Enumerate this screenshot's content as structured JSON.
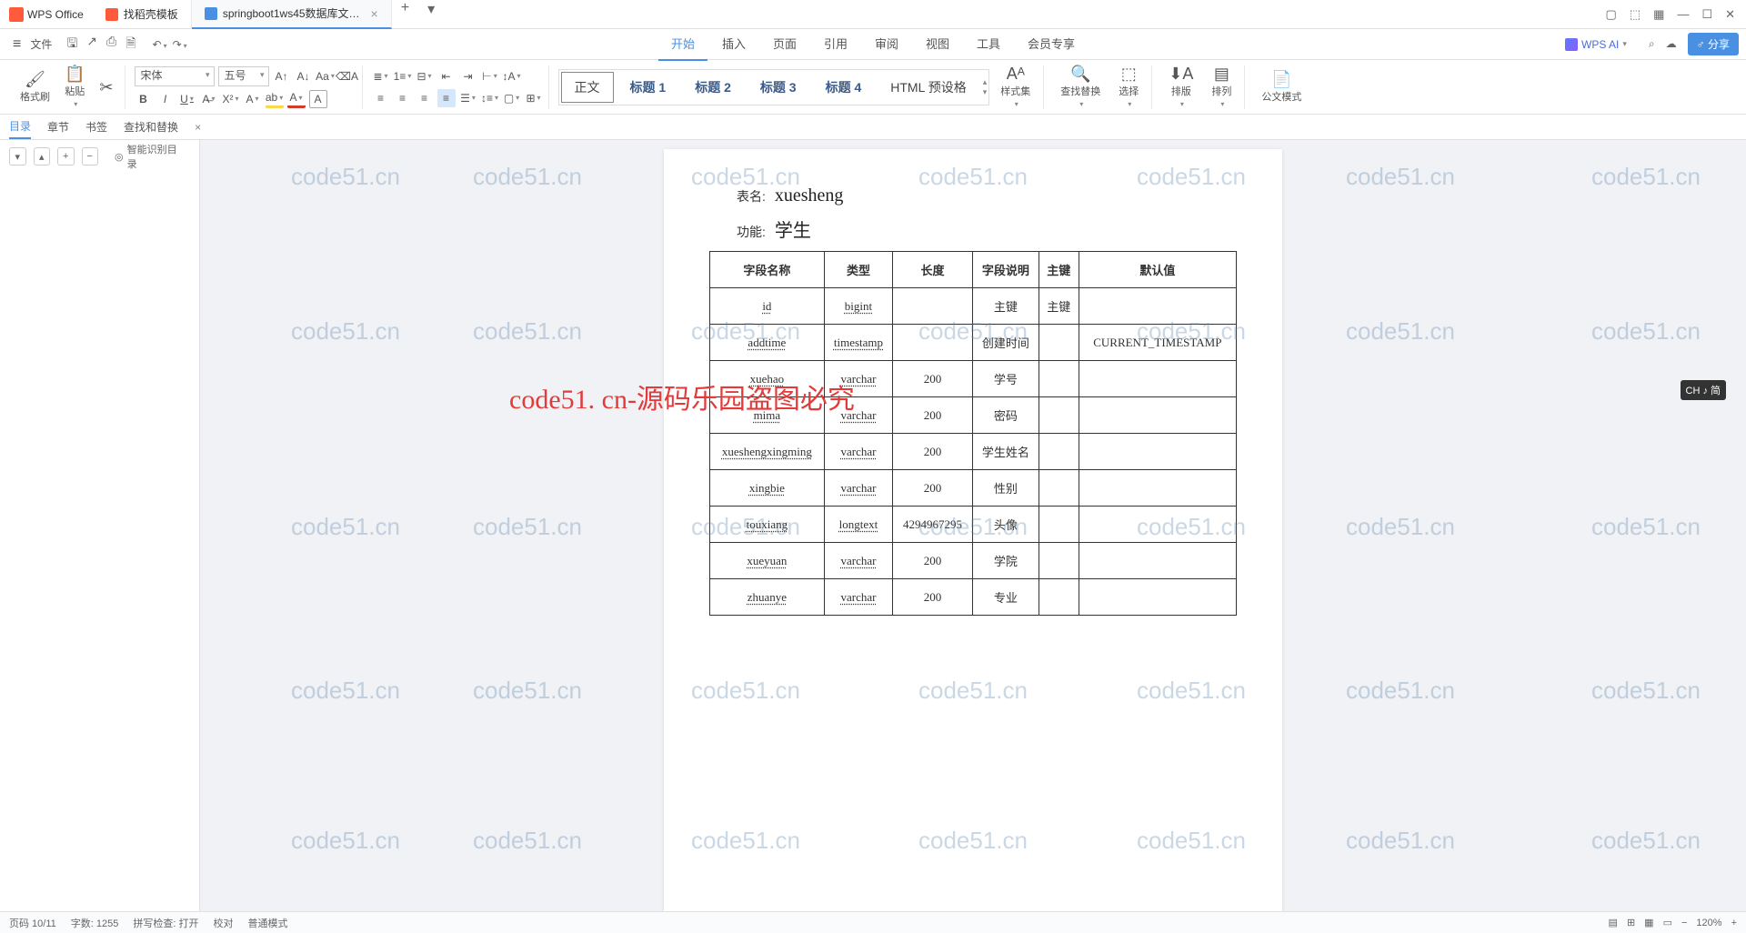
{
  "titlebar": {
    "app_name": "WPS Office",
    "tabs": [
      {
        "label": "找稻壳模板"
      },
      {
        "label": "springboot1ws45数据库文…"
      }
    ]
  },
  "menus": {
    "file": "文件",
    "items": [
      "开始",
      "插入",
      "页面",
      "引用",
      "审阅",
      "视图",
      "工具",
      "会员专享"
    ],
    "wps_ai": "WPS AI",
    "share": "分享"
  },
  "qat": {
    "undo": "↶",
    "redo": "↷"
  },
  "ribbon": {
    "format_painter": "格式刷",
    "paste": "粘贴",
    "font_name": "宋体",
    "font_size": "五号",
    "bold": "B",
    "italic": "I",
    "underline": "U",
    "style_main": "正文",
    "style_h1": "标题 1",
    "style_h2": "标题 2",
    "style_h3": "标题 3",
    "style_h4": "标题 4",
    "style_html": "HTML 预设格",
    "style_set": "样式集",
    "find_replace": "查找替换",
    "select": "选择",
    "layout": "排版",
    "arrange": "排列",
    "official": "公文模式"
  },
  "navpanel": {
    "tabs": [
      "目录",
      "章节",
      "书签",
      "查找和替换"
    ],
    "smart_toc": "智能识别目录"
  },
  "document": {
    "table_name_label": "表名:",
    "table_name_value": "xuesheng",
    "function_label": "功能:",
    "function_value": "学生",
    "columns": [
      "字段名称",
      "类型",
      "长度",
      "字段说明",
      "主键",
      "默认值"
    ],
    "rows": [
      {
        "name": "id",
        "type": "bigint",
        "len": "",
        "desc": "主键",
        "pk": "主键",
        "def": ""
      },
      {
        "name": "addtime",
        "type": "timestamp",
        "len": "",
        "desc": "创建时间",
        "pk": "",
        "def": "CURRENT_TIMESTAMP"
      },
      {
        "name": "xuehao",
        "type": "varchar",
        "len": "200",
        "desc": "学号",
        "pk": "",
        "def": ""
      },
      {
        "name": "mima",
        "type": "varchar",
        "len": "200",
        "desc": "密码",
        "pk": "",
        "def": ""
      },
      {
        "name": "xueshengxingming",
        "type": "varchar",
        "len": "200",
        "desc": "学生姓名",
        "pk": "",
        "def": ""
      },
      {
        "name": "xingbie",
        "type": "varchar",
        "len": "200",
        "desc": "性别",
        "pk": "",
        "def": ""
      },
      {
        "name": "touxiang",
        "type": "longtext",
        "len": "4294967295",
        "desc": "头像",
        "pk": "",
        "def": ""
      },
      {
        "name": "xueyuan",
        "type": "varchar",
        "len": "200",
        "desc": "学院",
        "pk": "",
        "def": ""
      },
      {
        "name": "zhuanye",
        "type": "varchar",
        "len": "200",
        "desc": "专业",
        "pk": "",
        "def": ""
      }
    ]
  },
  "watermark": {
    "text": "code51.cn",
    "banner": "code51. cn-源码乐园盗图必究"
  },
  "ime": "CH ♪ 简",
  "status": {
    "page": "页码 10/11",
    "words": "字数: 1255",
    "spell": "拼写检查: 打开",
    "proof": "校对",
    "mode": "普通模式",
    "zoom": "120%"
  }
}
